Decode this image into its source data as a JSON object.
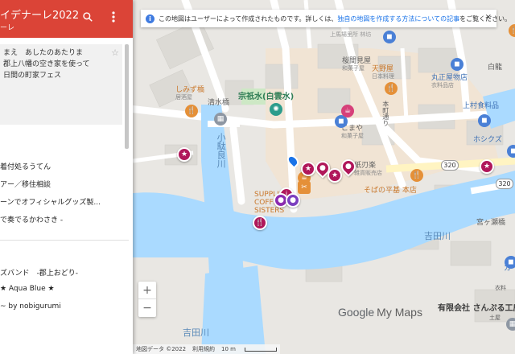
{
  "sidebar": {
    "title": "イデナーレ2022",
    "subtitle": "ーレ",
    "description_lines": [
      "まえ　あしたのあたりま",
      "郡上八幡の空き家を使って",
      "日間の町家フェス"
    ],
    "items": [
      "着付処るうてん",
      "アー／移住相談",
      "ーンでオフィシャルグッズ製...",
      "で奏でるかわさき -",
      "ズバンド　-郡上おどり-",
      "★ Aqua Blue ★",
      "~ by nobigurumi"
    ]
  },
  "banner": {
    "text": "この地図はユーザーによって作成されたものです。詳しくは、",
    "link": "独自の地図を作成する方法についての記事",
    "text_end": "をご覧ください。",
    "close": "×"
  },
  "map": {
    "labels": {
      "sakuramabashi": "桜間見屋",
      "sakuramabashi_sub": "和菓子屋",
      "tennoya": "天野屋",
      "tennoya_sub": "日本料理",
      "marusho": "丸正屋物店",
      "marusho_sub": "衣料品店",
      "shiroku": "白龍",
      "uemura": "上村食料品",
      "shimizubashi": "しみず橋",
      "shimizubashi_sub": "居酒屋",
      "seisuibashi": "清水橋",
      "sogisui": "宗祇水(白雲水)",
      "honmachi": "本町通り",
      "komaya": "こまや",
      "komaya_sub": "和菓子屋",
      "hoshikuzu": "ホシクズ",
      "kamiyaraku": "紙刃楽",
      "kamiyaraku_sub": "雑貨販売店",
      "sobanohiraki": "そばの平基 本店",
      "supplies": "SUPPLIES COFFEE SISTERS",
      "miyagase": "宮ヶ瀬橋",
      "yoshidagawa": "吉田川",
      "yoshidagawa2": "吉田川",
      "odaragawa": "小駄良川",
      "sanburu": "有限会社 さんぷる工房",
      "doshinya": "土屋",
      "ka": "カ",
      "kimono": "衣料",
      "road_320a": "320",
      "road_320b": "320",
      "kamiyaraku_top": "上馬場里所 林坊"
    }
  },
  "controls": {
    "zoom_in": "+",
    "zoom_out": "−"
  },
  "branding": {
    "google": "Google",
    "mymaps": "My Maps"
  },
  "footer": {
    "mapdata": "地図データ ©2022",
    "terms": "利用規約",
    "scale": "10 m"
  }
}
